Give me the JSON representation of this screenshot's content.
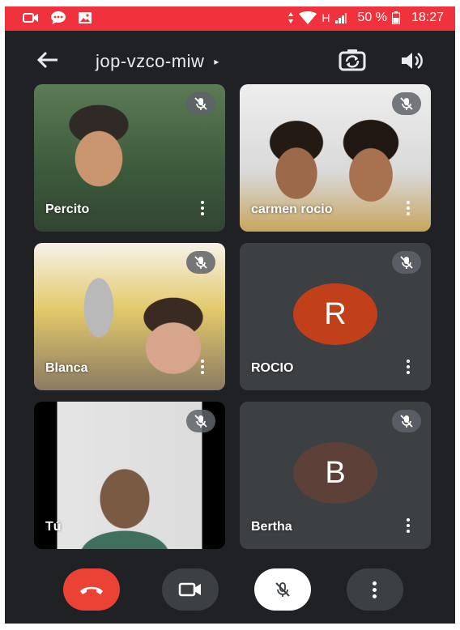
{
  "status_bar": {
    "network": "H",
    "battery": "50 %",
    "time": "18:27"
  },
  "header": {
    "meeting_code": "jop-vzco-miw",
    "caret": "▸"
  },
  "participants": [
    {
      "name": "Percito"
    },
    {
      "name": "carmen rocio"
    },
    {
      "name": "Blanca"
    },
    {
      "name": "ROCIO",
      "initial": "R",
      "avatar_color": "#c1401a"
    },
    {
      "name": "Tú"
    },
    {
      "name": "Bertha",
      "initial": "B",
      "avatar_color": "#5d4037"
    }
  ],
  "colors": {
    "background": "#202124",
    "tile": "#3c4043",
    "status_bar": "#f0323c",
    "end_call": "#ea4335"
  },
  "icons": {
    "back": "arrow-left-icon",
    "switch_camera": "switch-camera-icon",
    "speaker": "speaker-icon",
    "muted": "mic-off-icon",
    "more": "more-vert-icon",
    "end_call": "phone-hangup-icon",
    "camera": "videocam-icon"
  }
}
